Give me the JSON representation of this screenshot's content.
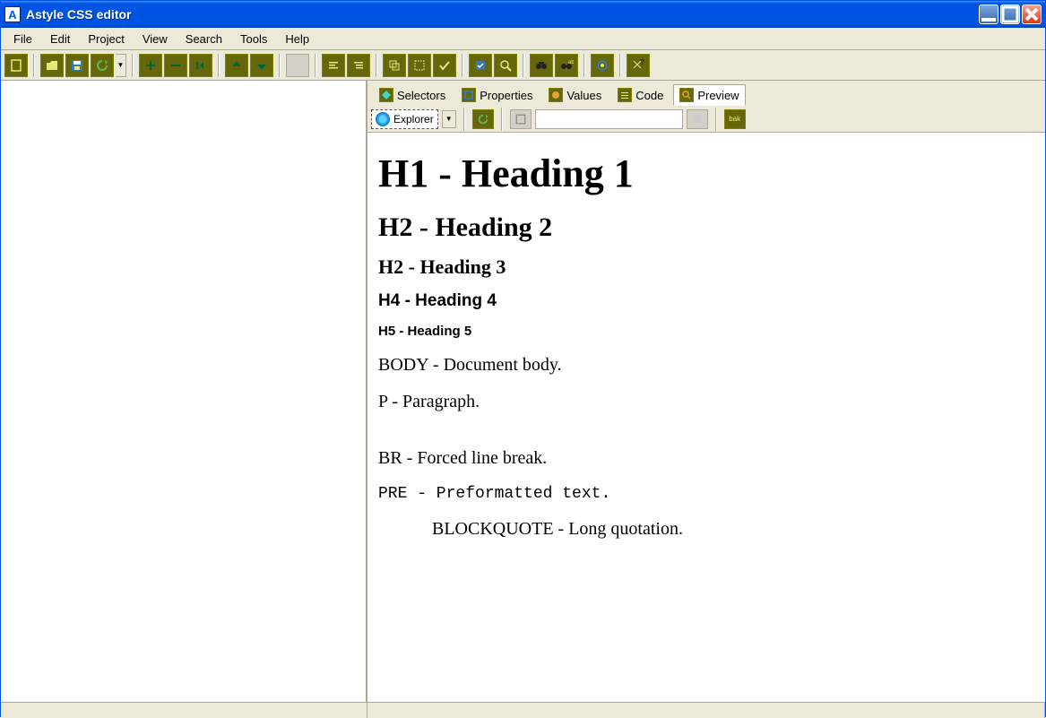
{
  "window": {
    "title": "Astyle CSS editor",
    "app_letter": "A"
  },
  "menu": [
    "File",
    "Edit",
    "Project",
    "View",
    "Search",
    "Tools",
    "Help"
  ],
  "tabs": [
    {
      "label": "Selectors",
      "icon": "diamond-icon"
    },
    {
      "label": "Properties",
      "icon": "square-icon"
    },
    {
      "label": "Values",
      "icon": "circle-icon"
    },
    {
      "label": "Code",
      "icon": "lines-icon"
    },
    {
      "label": "Preview",
      "icon": "magnifier-icon",
      "active": true
    }
  ],
  "browser": {
    "name": "Explorer"
  },
  "toolbar_icons": [
    "new-file-icon",
    "open-icon",
    "save-icon",
    "refresh-icon",
    "add-icon",
    "remove-icon",
    "indent-icon",
    "move-up-icon",
    "move-down-icon",
    "disabled-square-icon",
    "align-left-icon",
    "align-tree-icon",
    "clone-icon",
    "select-icon",
    "check-icon",
    "validate-icon",
    "find-icon",
    "binoculars-icon",
    "binoculars-replace-icon",
    "settings-icon",
    "help-icon"
  ],
  "preview": {
    "h1": "H1 - Heading 1",
    "h2": "H2 - Heading 2",
    "h3": "H2 - Heading 3",
    "h4": "H4 - Heading 4",
    "h5": "H5 - Heading 5",
    "body_line": "BODY - Document body.",
    "p_line": "P - Paragraph.",
    "br_line": "BR - Forced line break.",
    "pre_line": "PRE - Preformatted text.",
    "blockquote_line": "BLOCKQUOTE - Long quotation."
  },
  "bak_label": "bak"
}
